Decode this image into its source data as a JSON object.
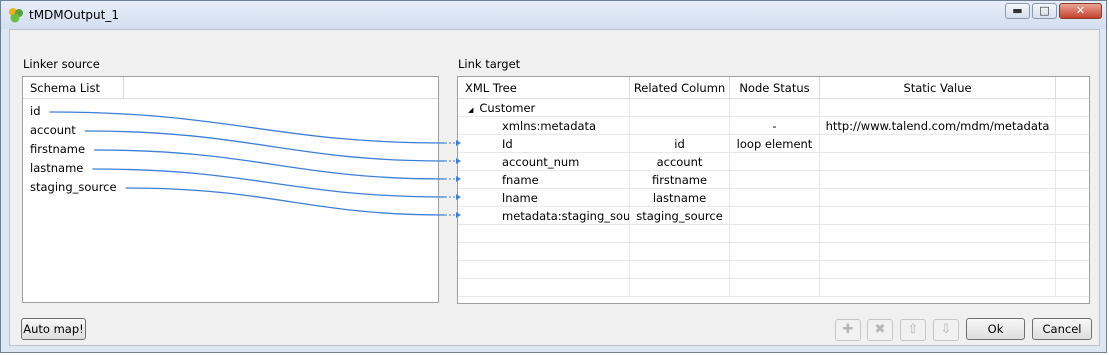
{
  "window": {
    "title": "tMDMOutput_1",
    "icons": {
      "app": "talend-component-icon",
      "minimize": "minimize-icon",
      "maximize": "maximize-icon",
      "close": "close-icon"
    }
  },
  "source": {
    "group_label": "Linker source",
    "column_header": "Schema List",
    "items": [
      "id",
      "account",
      "firstname",
      "lastname",
      "staging_source"
    ]
  },
  "target": {
    "group_label": "Link target",
    "headers": [
      "XML Tree",
      "Related Column",
      "Node Status",
      "Static Value"
    ],
    "root": "Customer",
    "rows": [
      {
        "node": "xmlns:metadata",
        "related": "",
        "status": "-",
        "static": "http://www.talend.com/mdm/metadata"
      },
      {
        "node": "Id",
        "related": "id",
        "status": "loop element",
        "static": ""
      },
      {
        "node": "account_num",
        "related": "account",
        "status": "",
        "static": ""
      },
      {
        "node": "fname",
        "related": "firstname",
        "status": "",
        "static": ""
      },
      {
        "node": "lname",
        "related": "lastname",
        "status": "",
        "static": ""
      },
      {
        "node": "metadata:staging_source",
        "related": "staging_source",
        "status": "",
        "static": ""
      }
    ]
  },
  "links": [
    {
      "from": "id",
      "to": "Id"
    },
    {
      "from": "account",
      "to": "account_num"
    },
    {
      "from": "firstname",
      "to": "fname"
    },
    {
      "from": "lastname",
      "to": "lname"
    },
    {
      "from": "staging_source",
      "to": "metadata:staging_source"
    }
  ],
  "link_color": "#3d7fd8",
  "buttons": {
    "auto_map": "Auto map!",
    "ok": "Ok",
    "cancel": "Cancel"
  },
  "toolbar_icons": [
    "add-icon",
    "delete-icon",
    "move-up-icon",
    "move-down-icon"
  ]
}
